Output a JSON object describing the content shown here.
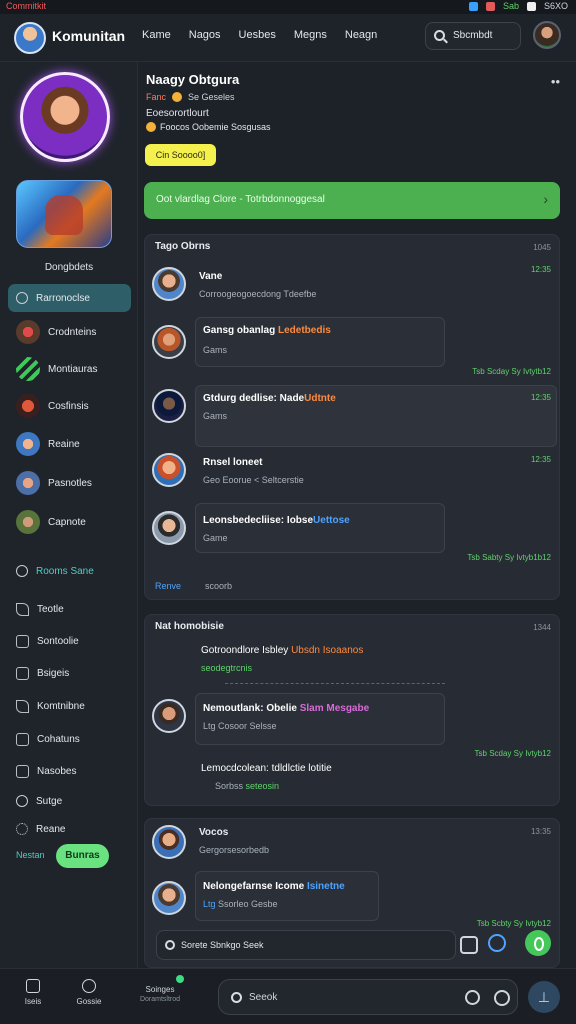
{
  "status_bar": {
    "left": "Commitkit",
    "right": [
      "Sab",
      "S6XO"
    ]
  },
  "topnav": {
    "title": "Komunitan",
    "links": [
      "Kame",
      "Nagos",
      "Uesbes",
      "Megns",
      "Neagn"
    ],
    "search_label": "Sbcmbdt"
  },
  "sidebar": {
    "caption": "Dongbdets",
    "active_item": "Rarronoclse",
    "items": [
      "Crodnteins",
      "Montiauras",
      "Cosfinsis",
      "Reaine",
      "Pasnotles",
      "Capnote"
    ],
    "link_item": "Rooms Sane",
    "menu": [
      "Teotle",
      "Sontoolie",
      "Bsigeis",
      "Komtnibne",
      "Cohatuns",
      "Nasobes",
      "Sutge",
      "Reane"
    ],
    "status_label": "Nestan",
    "status_button": "Bunras"
  },
  "profile": {
    "name": "Naagy Obtgura",
    "meta_accent": "Fanc",
    "meta_rest": "Se Geseles",
    "bio": "Eoesorortlourt",
    "tags": "Foocos Oobemie Sosgusas",
    "button": "Cin Soooo0]"
  },
  "banner": {
    "text": "Oot vlardlag  Clore - Totrbdonnoggesal",
    "chevron": "›"
  },
  "panel1": {
    "title": "Tago Obrns",
    "time": "1045",
    "messages": [
      {
        "name": "Vane",
        "text": "Corroogeogoecdong  Tdeefbe",
        "time": "12:35"
      },
      {
        "name": "Gansg obanlag ",
        "name_hl": "Ledetbedis",
        "text": "Gams",
        "time": "Tsb Scday Sy Ivtytb12"
      },
      {
        "name": "Gtdurg dedlise: Nade",
        "name_hl": "Udtnte",
        "text": "Gams",
        "time": "12:35"
      },
      {
        "name": "Rnsel loneet",
        "text": "Geo Eoorue < Seltcerstie",
        "time": "12:35"
      },
      {
        "name": "Leonsbedecliise: Iobse",
        "name_hl": "Uettose",
        "text": "Game",
        "time": "Tsb Sabty Sy Ivtyb1b12"
      }
    ],
    "footer": [
      "Renve",
      "scoorb"
    ]
  },
  "panel2": {
    "title": "Nat homobisie",
    "time": "1344",
    "messages": [
      {
        "name": "Gotroondlore Isbley",
        "name_hl": "Ubsdn Isoaanos",
        "text": "seodegtrcnis",
        "time": ""
      },
      {
        "name": "Nemoutlank: Obelie",
        "name_hl": "Slam Mesgabe",
        "text": "Ltg Cosoor Selsse",
        "time": "Tsb Scday Sy Ivtyb12"
      },
      {
        "name": "Lemocdcolean: tdldlctie lotitie",
        "name_hl": "",
        "text": "Sorbss",
        "text_hl": "seteosin",
        "time": ""
      }
    ]
  },
  "panel3": {
    "title": "Vocos",
    "time": "13:35",
    "messages": [
      {
        "name": "Vocos",
        "text": "Gergorsesorbedb",
        "time": "13:35"
      },
      {
        "name": "Nelongefarnse Icome",
        "name_hl": "Isinetne",
        "text_hl": "Ltg",
        "text": "Ssorleo Gesbe",
        "time": "Tsb Scbty Sy Ivtyb12"
      }
    ]
  },
  "composer": {
    "placeholder": "Sorete Sbnkgo Seek"
  },
  "tabbar": {
    "tabs": [
      "Iseis",
      "Gossie",
      "Soinges"
    ],
    "tabs_sub": [
      "",
      "",
      "Doramtsltrod"
    ],
    "search": "Seeok"
  },
  "colors": {
    "accent_green": "#46c75a",
    "banner_green": "#4caf50",
    "active_teal": "#2e5f68",
    "yellow": "#f4f14e"
  }
}
